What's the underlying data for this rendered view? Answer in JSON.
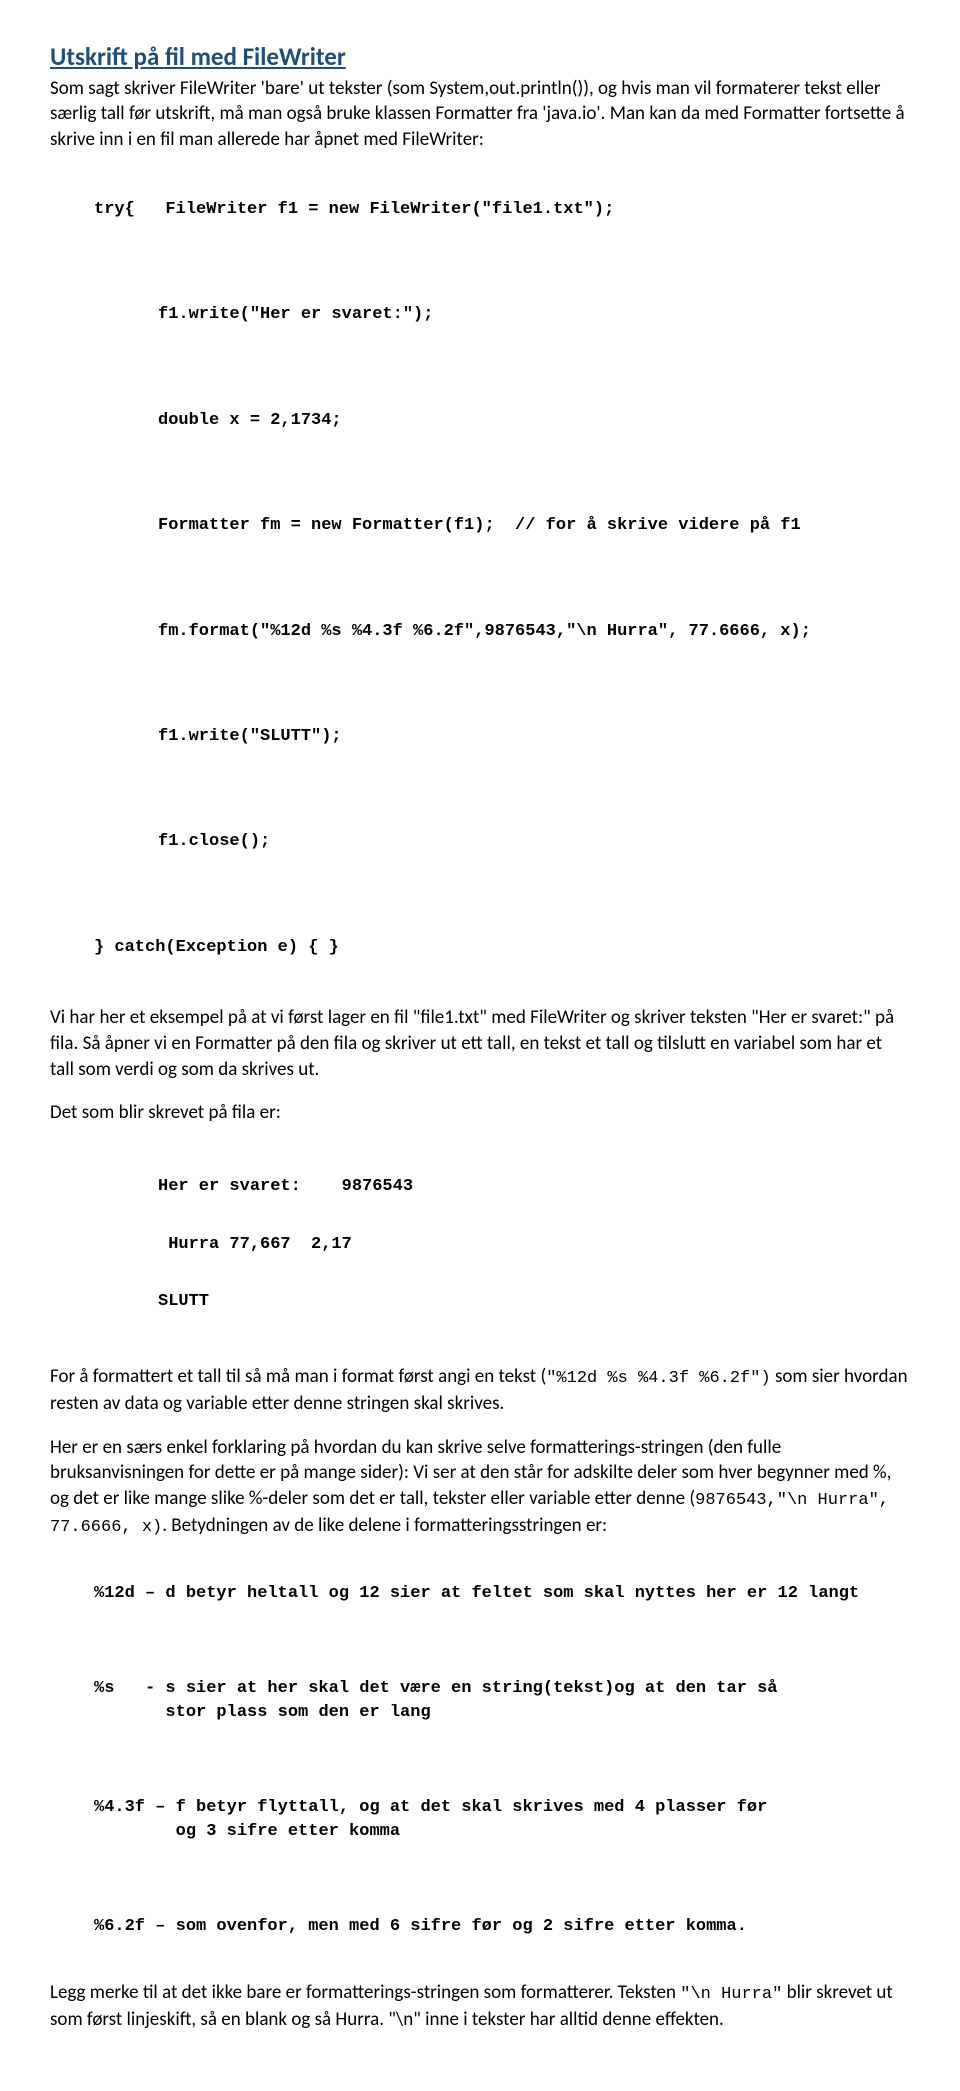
{
  "heading": "Utskrift på fil med FileWriter",
  "para1": "Som sagt skriver FileWriter 'bare' ut tekster (som System,out.println()), og hvis man vil formaterer tekst eller særlig tall før utskrift, må man også bruke klassen Formatter fra 'java.io'. Man kan da med Formatter fortsette å skrive inn i en fil man allerede har åpnet med FileWriter:",
  "code": {
    "l1": "try{   FileWriter f1 = new FileWriter(\"file1.txt\");",
    "l2": "f1.write(\"Her er svaret:\");",
    "l3": "double x = 2,1734;",
    "l4": "Formatter fm = new Formatter(f1);  // for å skrive videre på f1",
    "l5": "fm.format(\"%12d %s %4.3f %6.2f\",9876543,\"\\n Hurra\", 77.6666, x);",
    "l6": "f1.write(\"SLUTT\");",
    "l7": "f1.close();",
    "l8": "} catch(Exception e) { }"
  },
  "para2": "Vi har her et eksempel på at vi først lager en fil \"file1.txt\" med FileWriter og skriver teksten \"Her er svaret:\" på fila. Så åpner vi en Formatter på den fila og skriver ut ett tall, en tekst et tall og  tilslutt  en variabel som har et tall som verdi og som da skrives ut.",
  "para3": "Det som blir skrevet på fila er:",
  "output": {
    "l1": "Her er svaret:    9876543",
    "l2": " Hurra 77,667  2,17",
    "l3": "SLUTT"
  },
  "para4a": "For å formattert et tall til så må man i format først angi en tekst (",
  "para4code": "\"%12d %s %4.3f %6.2f\")",
  "para4b": "  som sier hvordan resten av data og variable etter denne stringen skal skrives.",
  "para5a": "Her er en særs enkel forklaring på hvordan du kan skrive selve formatterings-stringen (den fulle bruksanvisningen for dette er på mange sider):  Vi ser at den står for adskilte deler som hver begynner med %, og det er like mange slike %-deler som det er tall, tekster eller variable etter denne (",
  "para5code": "9876543,\"\\n Hurra\", 77.6666, x)",
  "para5b": ". Betydningen av de like delene i formatteringsstringen er:",
  "fmt": {
    "l1": "%12d – d betyr heltall og 12 sier at feltet som skal nyttes her er 12 langt",
    "l2": "%s   - s sier at her skal det være en string(tekst)og at den tar så\n       stor plass som den er lang",
    "l3": "%4.3f – f betyr flyttall, og at det skal skrives med 4 plasser før\n        og 3 sifre etter komma",
    "l4": "%6.2f – som ovenfor, men med 6 sifre før og 2 sifre etter komma."
  },
  "para6a": "Legg merke til at det ikke bare er formatterings-stringen som formatterer. Teksten ",
  "para6code": "\"\\n Hurra\"",
  "para6b": "  blir skrevet ut som først linjeskift, så en blank og så Hurra. \"\\n\" inne i tekster har alltid denne effekten."
}
